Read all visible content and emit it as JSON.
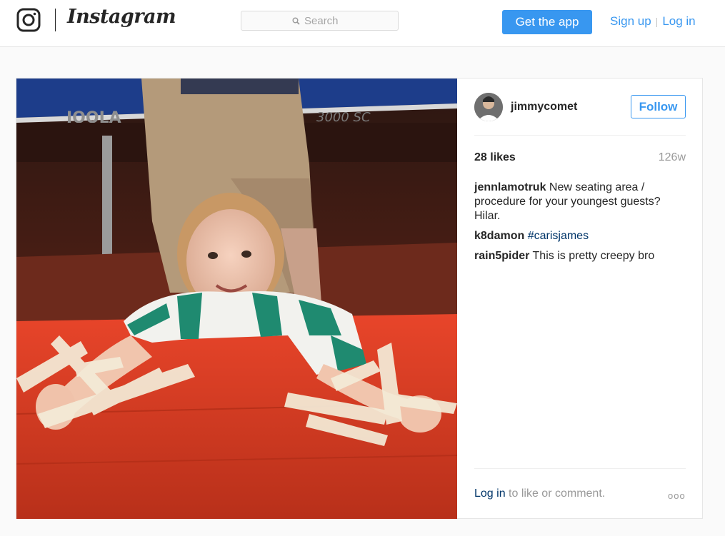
{
  "header": {
    "brand": "Instagram",
    "search_placeholder": "Search",
    "get_app_label": "Get the app",
    "signup_label": "Sign up",
    "separator": "|",
    "login_label": "Log in"
  },
  "post": {
    "username": "jimmycomet",
    "follow_label": "Follow",
    "likes": "28 likes",
    "age": "126w",
    "photo_signs": {
      "table_brand": "JOOLA",
      "table_model": "3000 SC"
    },
    "comments": [
      {
        "user": "jennlamotruk",
        "text": "New seating area / procedure for your youngest guests? Hilar."
      },
      {
        "user": "k8damon",
        "tag": "#carisjames"
      },
      {
        "user": "rain5pider",
        "text": "This is pretty creepy bro"
      }
    ],
    "footer": {
      "login_label": "Log in",
      "rest_text": "to like or comment.",
      "more_label": "ooo"
    }
  },
  "colors": {
    "accent": "#3897f0",
    "link_dark": "#003569",
    "muted": "#999999",
    "table_red": "#d63a1f"
  },
  "icons": [
    "instagram-glyph-icon",
    "search-icon",
    "more-options-icon"
  ]
}
